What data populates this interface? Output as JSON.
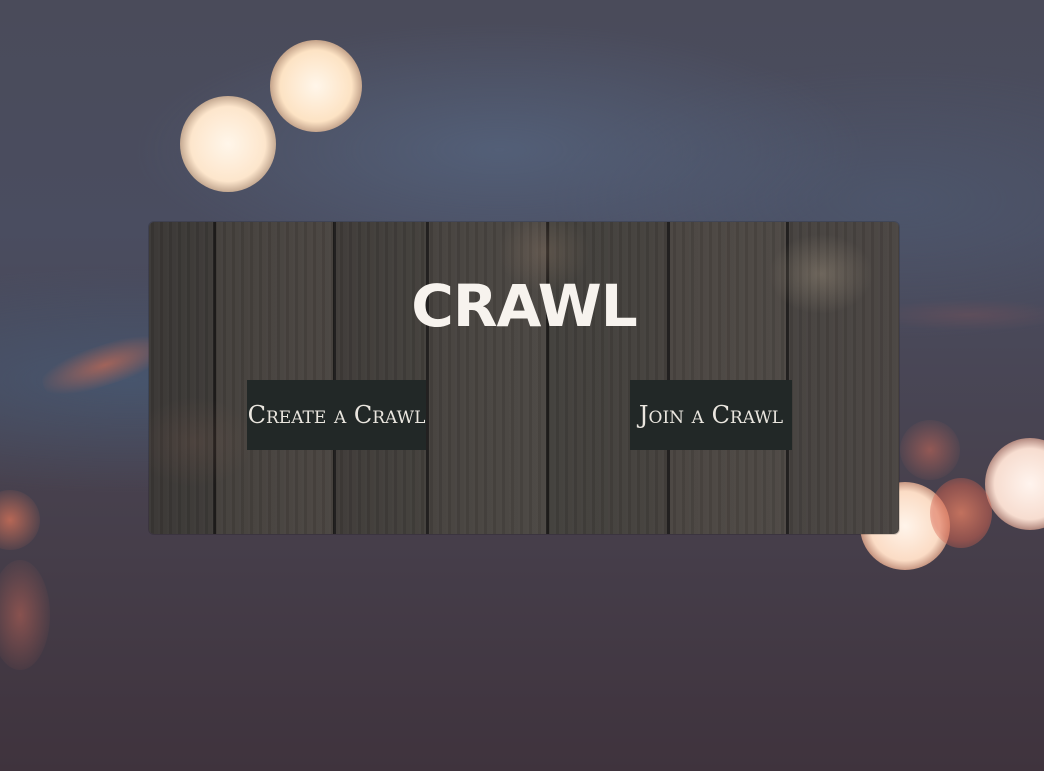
{
  "app": {
    "title": "CRAWL"
  },
  "actions": {
    "create_label": "Create a Crawl",
    "join_label": "Join a Crawl"
  },
  "colors": {
    "button_bg": "#222827",
    "button_text": "#eae6df",
    "title_text": "#f7f3ee"
  }
}
